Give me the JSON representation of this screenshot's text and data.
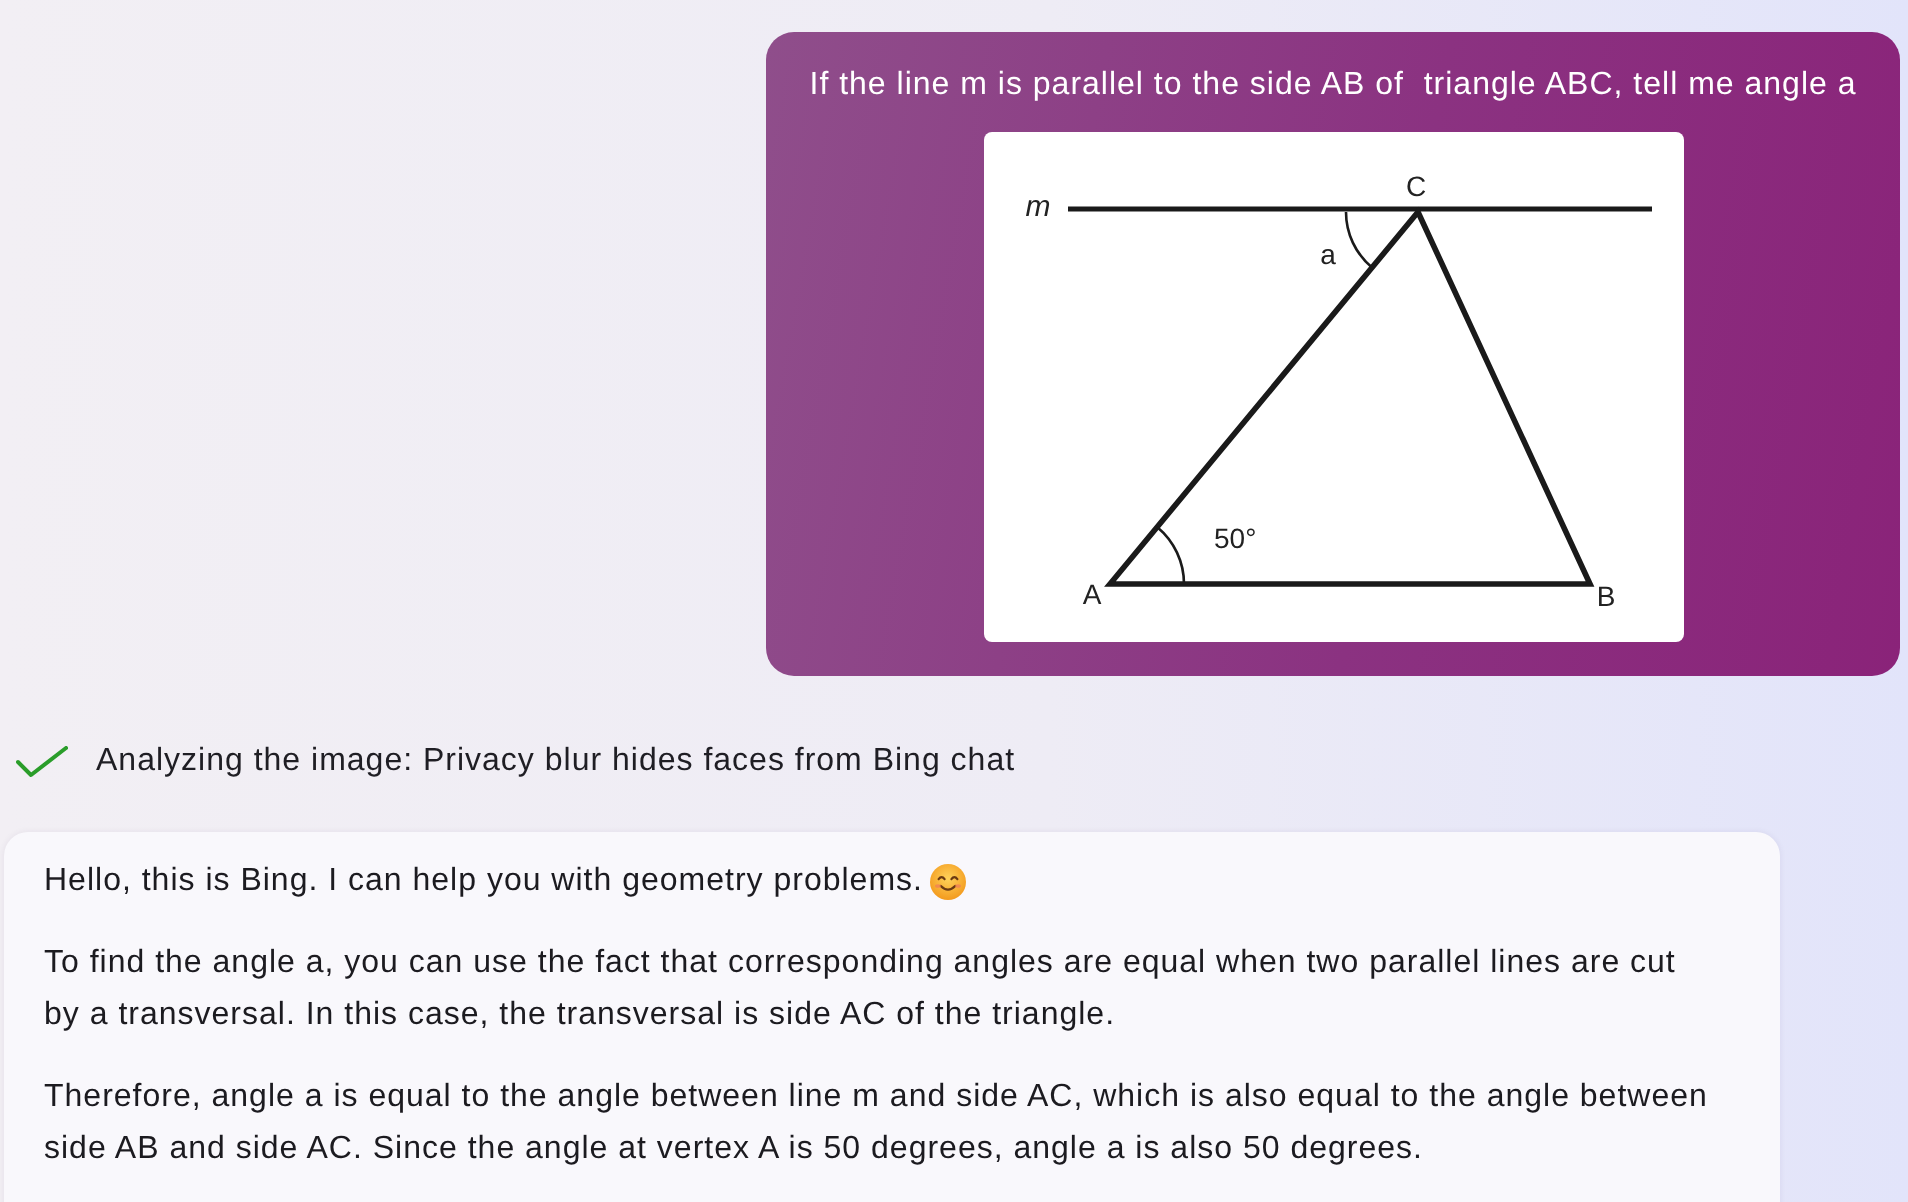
{
  "user_message": {
    "text": "If the line m is parallel to the side AB of  triangle ABC, tell me angle a",
    "diagram": {
      "line_label": "m",
      "vertices": [
        {
          "label": "C"
        },
        {
          "label": "A"
        },
        {
          "label": "B"
        }
      ],
      "angles": [
        {
          "label": "a"
        },
        {
          "label": "50°"
        }
      ]
    }
  },
  "status": {
    "done": true,
    "text": "Analyzing the image: Privacy blur hides faces from Bing chat"
  },
  "response": {
    "paragraphs": [
      {
        "text": "Hello, this is Bing. I can help you with geometry problems.",
        "has_emoji": true
      },
      {
        "text": "To find the angle a, you can use the fact that corresponding angles are equal when two parallel lines are cut by a transversal. In this case, the transversal is side AC of the triangle.",
        "has_emoji": false
      },
      {
        "text": "Therefore, angle a is equal to the angle between line m and side AC, which is also equal to the angle between side AB and side AC. Since the angle at vertex A is 50 degrees, angle a is also 50 degrees.",
        "has_emoji": false
      }
    ]
  }
}
